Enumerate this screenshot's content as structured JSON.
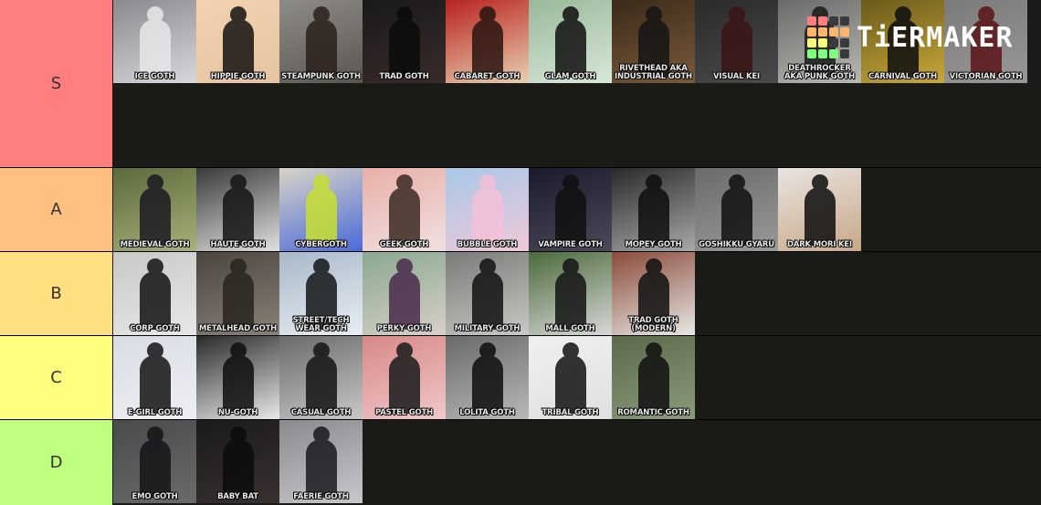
{
  "app": {
    "brand": "TiERMAKER"
  },
  "logo_grid_colors": [
    "#ff7f7f",
    "#ff7f7f",
    "#3a3a3a",
    "#3a3a3a",
    "#ffb56e",
    "#ffb56e",
    "#ffb56e",
    "#ffb56e",
    "#ffff7f",
    "#ffff7f",
    "#3a3a3a",
    "#3a3a3a",
    "#7fff7f",
    "#7fff7f",
    "#7fff7f",
    "#3a3a3a"
  ],
  "tiers": [
    {
      "label": "S",
      "color": "#ff7f7f",
      "items": [
        {
          "caption": "Ice Goth",
          "bg": [
            "#8a8a8e",
            "#d8d8dc"
          ],
          "fig": "#e8e8ea"
        },
        {
          "caption": "Hippie Goth",
          "bg": [
            "#f2d2b0",
            "#e6c4a2"
          ],
          "fig": "#151210"
        },
        {
          "caption": "Steampunk Goth",
          "bg": [
            "#8e8c88",
            "#5a5650"
          ],
          "fig": "#2a201c"
        },
        {
          "caption": "Trad Goth",
          "bg": [
            "#1a1a1a",
            "#3a2a2a"
          ],
          "fig": "#0b0b0b"
        },
        {
          "caption": "Cabaret Goth",
          "bg": [
            "#b8221e",
            "#e8d0b0"
          ],
          "fig": "#2a1410"
        },
        {
          "caption": "Glam Goth",
          "bg": [
            "#9ab89a",
            "#d8e8d8"
          ],
          "fig": "#101010"
        },
        {
          "caption": "Rivethead AKA Industrial Goth",
          "bg": [
            "#3a2a1a",
            "#7a5a3a"
          ],
          "fig": "#151515"
        },
        {
          "caption": "Visual Kei",
          "bg": [
            "#2a2a2a",
            "#4a4a4a"
          ],
          "fig": "#3a1414"
        },
        {
          "caption": "Deathrocker AKA Punk Goth",
          "bg": [
            "#6a6a68",
            "#b8b8b4"
          ],
          "fig": "#1a1a1a"
        },
        {
          "caption": "Carnival Goth",
          "bg": [
            "#6a5a1a",
            "#c8a83a"
          ],
          "fig": "#0e0e0e"
        },
        {
          "caption": "Victorian Goth",
          "bg": [
            "#7a7a78",
            "#9a9896"
          ],
          "fig": "#5a1418"
        }
      ]
    },
    {
      "label": "A",
      "color": "#ffbf7f",
      "items": [
        {
          "caption": "Medieval Goth",
          "bg": [
            "#5a6a3a",
            "#a8b07a"
          ],
          "fig": "#1a1a22"
        },
        {
          "caption": "Haute Goth",
          "bg": [
            "#3a3a3a",
            "#e0e0e0"
          ],
          "fig": "#141414"
        },
        {
          "caption": "Cybergoth",
          "bg": [
            "#d8d4c8",
            "#4a6ad8"
          ],
          "fig": "#c8e030"
        },
        {
          "caption": "Geek Goth",
          "bg": [
            "#e8b0a8",
            "#f0e0e0"
          ],
          "fig": "#3a2a22"
        },
        {
          "caption": "Bubble Goth",
          "bg": [
            "#a8c8e8",
            "#f0c8d8"
          ],
          "fig": "#f4c0d8"
        },
        {
          "caption": "Vampire Goth",
          "bg": [
            "#1a1a2a",
            "#4a4a5a"
          ],
          "fig": "#101010"
        },
        {
          "caption": "Mopey Goth",
          "bg": [
            "#2a2a2a",
            "#a8a8a8"
          ],
          "fig": "#0e0e0e"
        },
        {
          "caption": "Goshikku Gyaru",
          "bg": [
            "#6a6a6a",
            "#9a9a9a"
          ],
          "fig": "#101010"
        },
        {
          "caption": "Dark Mori Kei",
          "bg": [
            "#e8e4e0",
            "#c8a888"
          ],
          "fig": "#0e0e0e"
        }
      ]
    },
    {
      "label": "B",
      "color": "#ffdf7f",
      "items": [
        {
          "caption": "Corp Goth",
          "bg": [
            "#c8c8c8",
            "#e8e8e8"
          ],
          "fig": "#121212"
        },
        {
          "caption": "Metalhead Goth",
          "bg": [
            "#4a4440",
            "#8a8278"
          ],
          "fig": "#2a2420"
        },
        {
          "caption": "Street/Tech Wear Goth",
          "bg": [
            "#a8b8c8",
            "#e8eef4"
          ],
          "fig": "#14161a"
        },
        {
          "caption": "Perky Goth",
          "bg": [
            "#8aa890",
            "#d8d0c8"
          ],
          "fig": "#4a2a4a"
        },
        {
          "caption": "Military Goth",
          "bg": [
            "#7a7a78",
            "#c8c8c4"
          ],
          "fig": "#121212"
        },
        {
          "caption": "Mall Goth",
          "bg": [
            "#4a6a3a",
            "#d8d8d8"
          ],
          "fig": "#141414"
        },
        {
          "caption": "Trad Goth (Modern)",
          "bg": [
            "#8a4a3a",
            "#e8e8e4"
          ],
          "fig": "#101010"
        }
      ]
    },
    {
      "label": "C",
      "color": "#ffff7f",
      "items": [
        {
          "caption": "E-Girl Goth",
          "bg": [
            "#d8dce4",
            "#eef0f4"
          ],
          "fig": "#141414"
        },
        {
          "caption": "Nu-Goth",
          "bg": [
            "#2a2a2a",
            "#e8e8e8"
          ],
          "fig": "#0e0e0e"
        },
        {
          "caption": "Casual Goth",
          "bg": [
            "#6a6a6a",
            "#c8c8c8"
          ],
          "fig": "#141414"
        },
        {
          "caption": "Pastel Goth",
          "bg": [
            "#d88888",
            "#f0c8c8"
          ],
          "fig": "#1a1a1a"
        },
        {
          "caption": "Lolita Goth",
          "bg": [
            "#6a6a6a",
            "#b8b8b8"
          ],
          "fig": "#0e0e0e"
        },
        {
          "caption": "Tribal Goth",
          "bg": [
            "#f0f0f0",
            "#e0e0e0"
          ],
          "fig": "#121212"
        },
        {
          "caption": "Romantic Goth",
          "bg": [
            "#5a6a4a",
            "#8a9a7a"
          ],
          "fig": "#101010"
        }
      ]
    },
    {
      "label": "D",
      "color": "#bfff7f",
      "items": [
        {
          "caption": "Emo Goth",
          "bg": [
            "#4a4a4a",
            "#6a6a6a"
          ],
          "fig": "#141418"
        },
        {
          "caption": "Baby Bat",
          "bg": [
            "#1a1a1a",
            "#3a3030"
          ],
          "fig": "#0c0c0c"
        },
        {
          "caption": "Faerie Goth",
          "bg": [
            "#8a8a8e",
            "#c8c8cc"
          ],
          "fig": "#1a1a1e"
        }
      ]
    }
  ]
}
